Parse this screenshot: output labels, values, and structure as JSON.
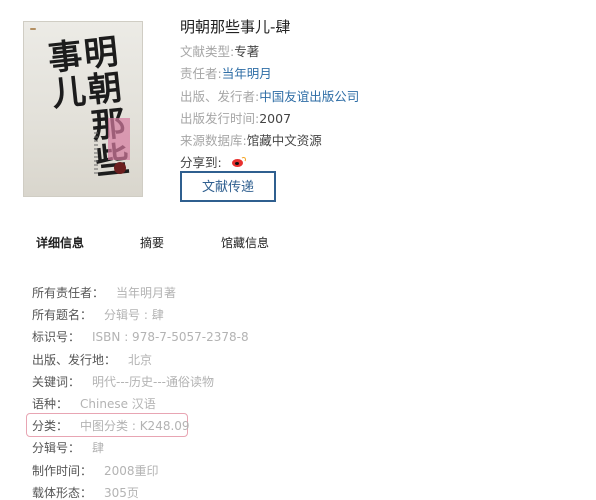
{
  "book": {
    "title": "明朝那些事儿-肆",
    "cover_brand": "",
    "cover_title": "明朝那些事儿"
  },
  "meta": [
    {
      "label": "文献类型:",
      "value": "专著",
      "kind": "plain"
    },
    {
      "label": "责任者:",
      "value": "当年明月",
      "kind": "link"
    },
    {
      "label": "出版、发行者:",
      "value": "中国友谊出版公司",
      "kind": "link"
    },
    {
      "label": "出版发行时间:",
      "value": "2007",
      "kind": "plain"
    },
    {
      "label": "来源数据库:",
      "value": "馆藏中文资源",
      "kind": "plain"
    }
  ],
  "share": {
    "label": "分享到:",
    "icon": "weibo-icon"
  },
  "deliver_button": "文献传递",
  "tabs": [
    {
      "label": "详细信息",
      "active": true
    },
    {
      "label": "摘要",
      "active": false
    },
    {
      "label": "馆藏信息",
      "active": false
    }
  ],
  "details": [
    {
      "key": "所有责任者：",
      "value": "当年明月著"
    },
    {
      "key": "所有题名：",
      "value": "分辑号 : 肆"
    },
    {
      "key": "标识号：",
      "value": "ISBN : 978-7-5057-2378-8"
    },
    {
      "key": "出版、发行地：",
      "value": "北京"
    },
    {
      "key": "关键词：",
      "value": "明代---历史---通俗读物"
    },
    {
      "key": "语种：",
      "value": "Chinese 汉语"
    },
    {
      "key": "分类：",
      "value": "中图分类 : K248.09"
    },
    {
      "key": "分辑号：",
      "value": "肆"
    },
    {
      "key": "制作时间：",
      "value": "2008重印"
    },
    {
      "key": "载体形态：",
      "value": "305页"
    }
  ],
  "colors": {
    "link": "#2f6ea6",
    "button_border": "#2f5f8f",
    "highlight_border": "#e8a5b3"
  }
}
